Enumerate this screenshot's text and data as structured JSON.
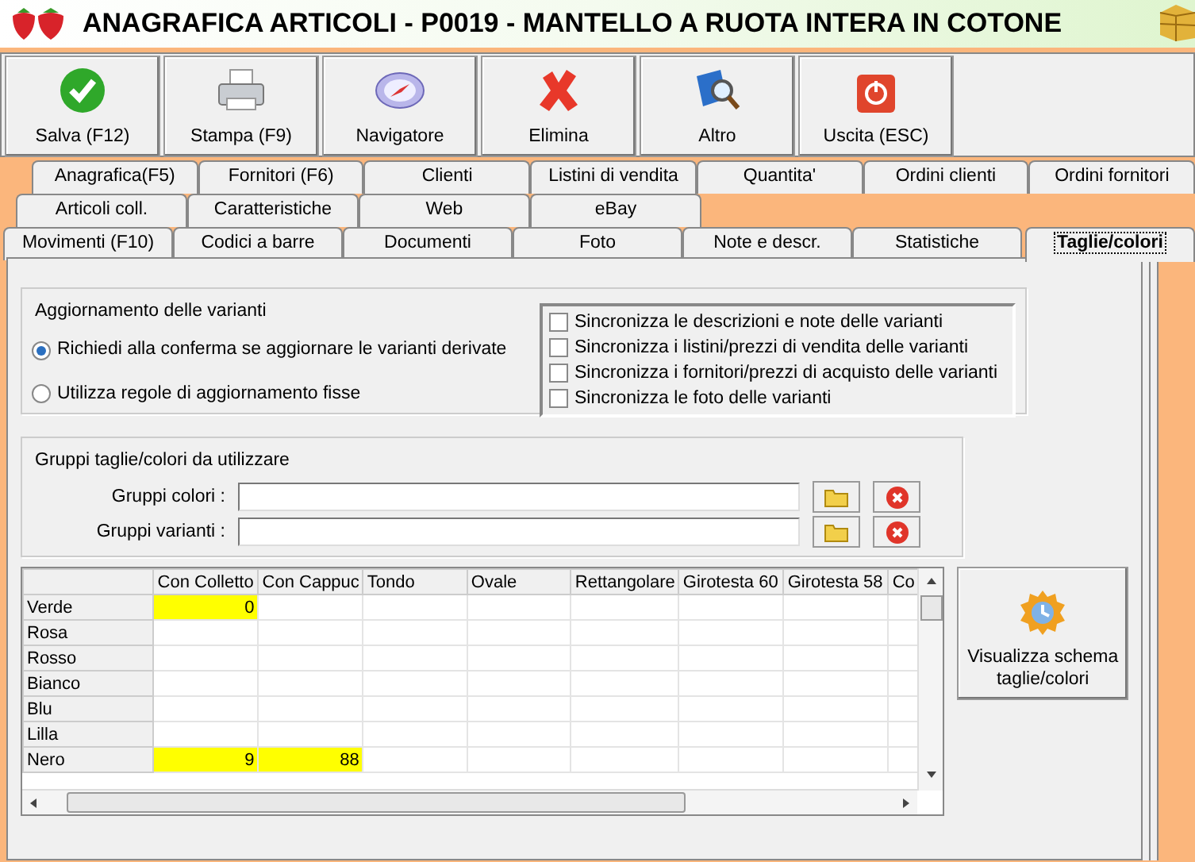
{
  "window": {
    "title": "ANAGRAFICA ARTICOLI - P0019 - MANTELLO A RUOTA INTERA IN COTONE"
  },
  "toolbar": [
    {
      "label": "Salva (F12)",
      "kind": "save"
    },
    {
      "label": "Stampa (F9)",
      "kind": "print"
    },
    {
      "label": "Navigatore",
      "kind": "compass"
    },
    {
      "label": "Elimina",
      "kind": "delete"
    },
    {
      "label": "Altro",
      "kind": "search"
    },
    {
      "label": "Uscita (ESC)",
      "kind": "exit"
    }
  ],
  "tab_rows": [
    [
      {
        "label": "Anagrafica(F5)",
        "selected": false
      },
      {
        "label": "Fornitori (F6)",
        "selected": false
      },
      {
        "label": "Clienti",
        "selected": false
      },
      {
        "label": "Listini di vendita",
        "selected": false
      },
      {
        "label": "Quantita'",
        "selected": false
      },
      {
        "label": "Ordini clienti",
        "selected": false
      },
      {
        "label": "Ordini fornitori",
        "selected": false
      }
    ],
    [
      {
        "label": "Articoli coll.",
        "selected": false
      },
      {
        "label": "Caratteristiche",
        "selected": false
      },
      {
        "label": "Web",
        "selected": false
      },
      {
        "label": "eBay",
        "selected": false
      }
    ],
    [
      {
        "label": "Movimenti (F10)",
        "selected": false
      },
      {
        "label": "Codici a barre",
        "selected": false
      },
      {
        "label": "Documenti",
        "selected": false
      },
      {
        "label": "Foto",
        "selected": false
      },
      {
        "label": "Note e descr.",
        "selected": false
      },
      {
        "label": "Statistiche",
        "selected": false
      },
      {
        "label": "Taglie/colori",
        "selected": true
      }
    ]
  ],
  "update_group": {
    "title": "Aggiornamento delle varianti",
    "radios": [
      {
        "label": "Richiedi alla conferma se aggiornare le varianti derivate",
        "selected": true
      },
      {
        "label": "Utilizza regole di aggiornamento fisse",
        "selected": false
      }
    ],
    "checkboxes": [
      {
        "label": "Sincronizza le descrizioni e note delle varianti",
        "checked": false
      },
      {
        "label": "Sincronizza i listini/prezzi di vendita delle varianti",
        "checked": false
      },
      {
        "label": "Sincronizza i fornitori/prezzi di acquisto delle varianti",
        "checked": false
      },
      {
        "label": "Sincronizza le foto delle varianti",
        "checked": false
      }
    ]
  },
  "groups_group": {
    "title": "Gruppi taglie/colori da utilizzare",
    "fields": [
      {
        "label": "Gruppi colori :"
      },
      {
        "label": "Gruppi varianti :"
      }
    ]
  },
  "grid": {
    "columns": [
      "Con Colletto",
      "Con Cappuc",
      "Tondo",
      "Ovale",
      "Rettangolare",
      "Girotesta 60",
      "Girotesta 58",
      "Co"
    ],
    "rows": [
      {
        "label": "Verde",
        "cells": [
          {
            "value": "0",
            "highlighted": true
          },
          {
            "highlighted": false
          },
          {
            "highlighted": false
          },
          {
            "highlighted": false
          },
          {
            "highlighted": false
          },
          {
            "highlighted": false
          },
          {
            "highlighted": false
          },
          {
            "highlighted": false
          }
        ]
      },
      {
        "label": "Rosa",
        "cells": [
          {
            "highlighted": false
          },
          {
            "highlighted": false
          },
          {
            "highlighted": false
          },
          {
            "highlighted": false
          },
          {
            "highlighted": false
          },
          {
            "highlighted": false
          },
          {
            "highlighted": false
          },
          {
            "highlighted": false
          }
        ]
      },
      {
        "label": "Rosso",
        "cells": [
          {
            "highlighted": false
          },
          {
            "highlighted": false
          },
          {
            "highlighted": false
          },
          {
            "highlighted": false
          },
          {
            "highlighted": false
          },
          {
            "highlighted": false
          },
          {
            "highlighted": false
          },
          {
            "highlighted": false
          }
        ]
      },
      {
        "label": "Bianco",
        "cells": [
          {
            "highlighted": false
          },
          {
            "highlighted": false
          },
          {
            "highlighted": false
          },
          {
            "highlighted": false
          },
          {
            "highlighted": false
          },
          {
            "highlighted": false
          },
          {
            "highlighted": false
          },
          {
            "highlighted": false
          }
        ]
      },
      {
        "label": "Blu",
        "cells": [
          {
            "highlighted": false
          },
          {
            "highlighted": false
          },
          {
            "highlighted": false
          },
          {
            "highlighted": false
          },
          {
            "highlighted": false
          },
          {
            "highlighted": false
          },
          {
            "highlighted": false
          },
          {
            "highlighted": false
          }
        ]
      },
      {
        "label": "Lilla",
        "cells": [
          {
            "highlighted": false
          },
          {
            "highlighted": false
          },
          {
            "highlighted": false
          },
          {
            "highlighted": false
          },
          {
            "highlighted": false
          },
          {
            "highlighted": false
          },
          {
            "highlighted": false
          },
          {
            "highlighted": false
          }
        ]
      },
      {
        "label": "Nero",
        "cells": [
          {
            "value": "9",
            "highlighted": true
          },
          {
            "value": "88",
            "highlighted": true
          },
          {
            "highlighted": false
          },
          {
            "highlighted": false
          },
          {
            "highlighted": false
          },
          {
            "highlighted": false
          },
          {
            "highlighted": false
          },
          {
            "highlighted": false
          }
        ]
      }
    ]
  },
  "schema_button": {
    "label": "Visualizza schema taglie/colori"
  }
}
